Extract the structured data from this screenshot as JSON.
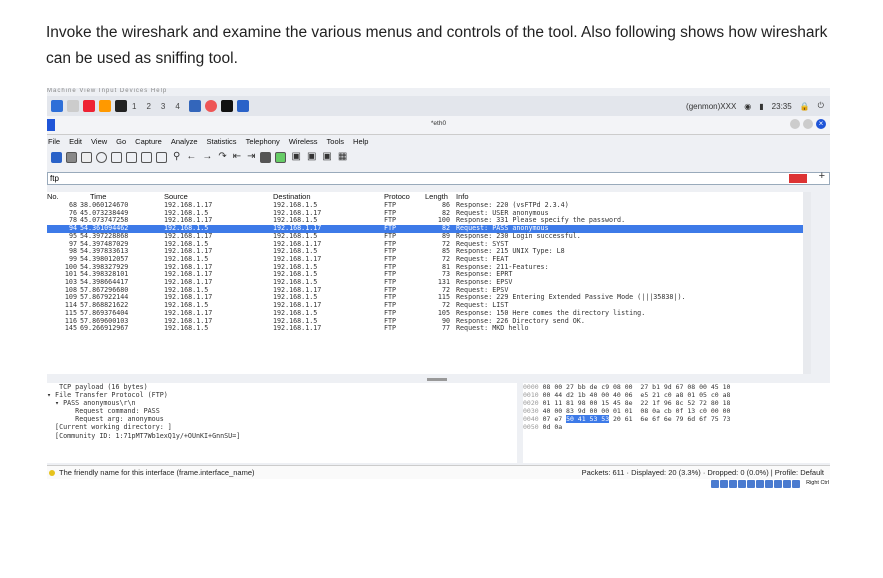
{
  "instruction": "Invoke the wireshark and examine the various menus  and controls of the tool. Also following shows how wireshark can be used as sniffing tool.",
  "topbar": {
    "workspaces": [
      "1",
      "2",
      "3",
      "4"
    ],
    "genmon": "(genmon)XXX",
    "clock": "23:35"
  },
  "window": {
    "title": "*eth0"
  },
  "menu": [
    "File",
    "Edit",
    "View",
    "Go",
    "Capture",
    "Analyze",
    "Statistics",
    "Telephony",
    "Wireless",
    "Tools",
    "Help"
  ],
  "filter": {
    "value": "ftp"
  },
  "columns": {
    "no": "No.",
    "time": "Time",
    "source": "Source",
    "destination": "Destination",
    "protocol": "Protoco",
    "length": "Length",
    "info": "Info"
  },
  "packets": [
    {
      "no": "68",
      "time": "38.060124670",
      "src": "192.168.1.17",
      "dst": "192.168.1.5",
      "proto": "FTP",
      "len": "86",
      "info": "Response: 220 (vsFTPd 2.3.4)"
    },
    {
      "no": "76",
      "time": "45.073238449",
      "src": "192.168.1.5",
      "dst": "192.168.1.17",
      "proto": "FTP",
      "len": "82",
      "info": "Request: USER anonymous"
    },
    {
      "no": "78",
      "time": "45.073747258",
      "src": "192.168.1.17",
      "dst": "192.168.1.5",
      "proto": "FTP",
      "len": "100",
      "info": "Response: 331 Please specify the password."
    },
    {
      "no": "94",
      "time": "54.361094462",
      "src": "192.168.1.5",
      "dst": "192.168.1.17",
      "proto": "FTP",
      "len": "82",
      "info": "Request: PASS anonymous"
    },
    {
      "no": "95",
      "time": "54.397228868",
      "src": "192.168.1.17",
      "dst": "192.168.1.5",
      "proto": "FTP",
      "len": "89",
      "info": "Response: 230 Login successful."
    },
    {
      "no": "97",
      "time": "54.397487029",
      "src": "192.168.1.5",
      "dst": "192.168.1.17",
      "proto": "FTP",
      "len": "72",
      "info": "Request: SYST"
    },
    {
      "no": "98",
      "time": "54.397833613",
      "src": "192.168.1.17",
      "dst": "192.168.1.5",
      "proto": "FTP",
      "len": "85",
      "info": "Response: 215 UNIX Type: L8"
    },
    {
      "no": "99",
      "time": "54.398012057",
      "src": "192.168.1.5",
      "dst": "192.168.1.17",
      "proto": "FTP",
      "len": "72",
      "info": "Request: FEAT"
    },
    {
      "no": "100",
      "time": "54.398327929",
      "src": "192.168.1.17",
      "dst": "192.168.1.5",
      "proto": "FTP",
      "len": "81",
      "info": "Response: 211-Features:"
    },
    {
      "no": "101",
      "time": "54.398328101",
      "src": "192.168.1.17",
      "dst": "192.168.1.5",
      "proto": "FTP",
      "len": "73",
      "info": "Response:  EPRT"
    },
    {
      "no": "103",
      "time": "54.398664417",
      "src": "192.168.1.17",
      "dst": "192.168.1.5",
      "proto": "FTP",
      "len": "131",
      "info": "Response:  EPSV"
    },
    {
      "no": "108",
      "time": "57.867296680",
      "src": "192.168.1.5",
      "dst": "192.168.1.17",
      "proto": "FTP",
      "len": "72",
      "info": "Request: EPSV"
    },
    {
      "no": "109",
      "time": "57.867922144",
      "src": "192.168.1.17",
      "dst": "192.168.1.5",
      "proto": "FTP",
      "len": "115",
      "info": "Response: 229 Entering Extended Passive Mode (|||35838|)."
    },
    {
      "no": "114",
      "time": "57.868821622",
      "src": "192.168.1.5",
      "dst": "192.168.1.17",
      "proto": "FTP",
      "len": "72",
      "info": "Request: LIST"
    },
    {
      "no": "115",
      "time": "57.869376404",
      "src": "192.168.1.17",
      "dst": "192.168.1.5",
      "proto": "FTP",
      "len": "105",
      "info": "Response: 150 Here comes the directory listing."
    },
    {
      "no": "116",
      "time": "57.869600103",
      "src": "192.168.1.17",
      "dst": "192.168.1.5",
      "proto": "FTP",
      "len": "90",
      "info": "Response: 226 Directory send OK."
    },
    {
      "no": "145",
      "time": "69.266912967",
      "src": "192.168.1.5",
      "dst": "192.168.1.17",
      "proto": "FTP",
      "len": "77",
      "info": "Request: MKD hello"
    }
  ],
  "details": [
    "   TCP payload (16 bytes)",
    "▾ File Transfer Protocol (FTP)",
    "  ▾ PASS anonymous\\r\\n",
    "       Request command: PASS",
    "       Request arg: anonymous",
    "  [Current working directory: ]",
    "  [Community ID: 1:71pMT7Wb1exQ1y/+OUnKI+GnnSU=]"
  ],
  "hex": [
    {
      "off": "0000",
      "bytes": "08 00 27 bb de c9 08 00  27 b1 9d 67 08 00 45 10"
    },
    {
      "off": "0010",
      "bytes": "00 44 d2 1b 40 00 40 06  e5 21 c0 a8 01 05 c0 a8"
    },
    {
      "off": "0020",
      "bytes": "01 11 81 98 00 15 45 8e  22 1f 96 8c 52 72 80 18"
    },
    {
      "off": "0030",
      "bytes": "40 00 83 9d 00 00 01 01  08 0a cb 0f 13 c0 00 00"
    },
    {
      "off": "0040",
      "pre": "07 e7 ",
      "hl": "50 41 53 53",
      "post": " 20 61  6e 6f 6e 79 6d 6f 75 73"
    },
    {
      "off": "0050",
      "bytes": "0d 0a"
    }
  ],
  "status": {
    "left": "The friendly name for this interface (frame.interface_name)",
    "right": "Packets: 611 · Displayed: 20 (3.3%) · Dropped: 0 (0.0%)  |  Profile: Default"
  },
  "tray": {
    "label": "Right Ctrl"
  },
  "selected_row_index": 3
}
